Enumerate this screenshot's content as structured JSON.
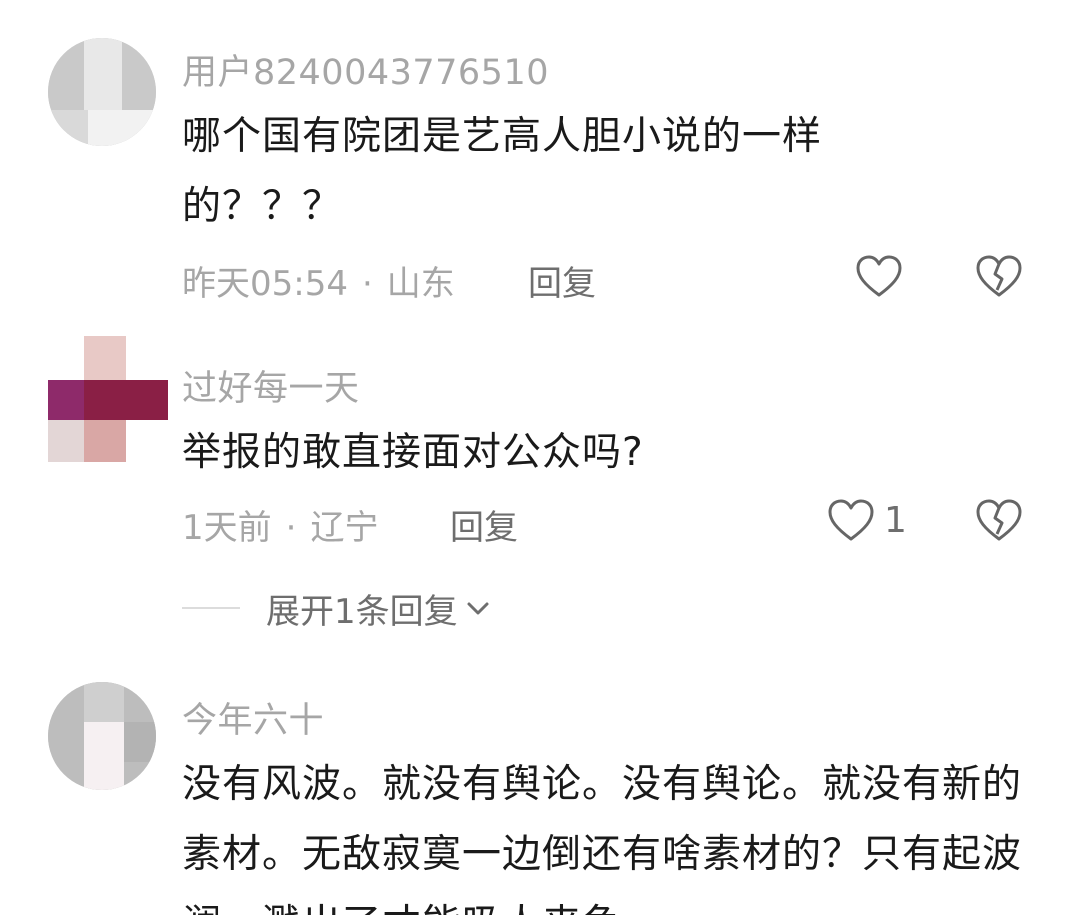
{
  "comments": [
    {
      "username": "用户8240043776510",
      "content": "哪个国有院团是艺高人胆小说的一样的？？？",
      "time": "昨天05:54",
      "separator": "·",
      "location": "山东",
      "reply_label": "回复",
      "like_count": ""
    },
    {
      "username": "过好每一天",
      "content": "举报的敢直接面对公众吗?",
      "time": "1天前",
      "separator": "·",
      "location": "辽宁",
      "reply_label": "回复",
      "like_count": "1",
      "expand_replies_label": "展开1条回复"
    },
    {
      "username": "今年六十",
      "content": "没有风波。就没有舆论。没有舆论。就没有新的素材。无敌寂寞一边倒还有啥素材的？只有起波澜，溅出了才能吸人来鱼"
    }
  ],
  "icons": {
    "like": "heart-outline-icon",
    "dislike": "broken-heart-icon",
    "expand": "chevron-down-icon"
  },
  "colors": {
    "text_primary": "#1a1a1a",
    "text_secondary": "#a6a6a6",
    "text_action": "#6e6e6e",
    "background": "#ffffff"
  }
}
